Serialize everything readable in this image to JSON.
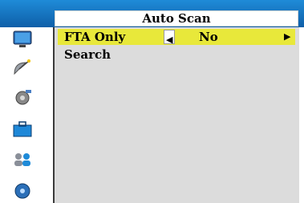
{
  "header": {
    "title": "Auto Scan"
  },
  "sidebar": {
    "icons": [
      "tv-icon",
      "satellite-dish-icon",
      "settings-icon",
      "toolbox-icon",
      "users-icon",
      "media-icon"
    ]
  },
  "menu": {
    "items": [
      {
        "label": "FTA Only",
        "value": "No",
        "selected": true
      },
      {
        "label": "Search",
        "value": "",
        "selected": false
      }
    ]
  },
  "colors": {
    "title_blue": "#1f8bd8",
    "highlight_yellow": "#e8e83a",
    "panel_gray": "#dcdcdc"
  }
}
